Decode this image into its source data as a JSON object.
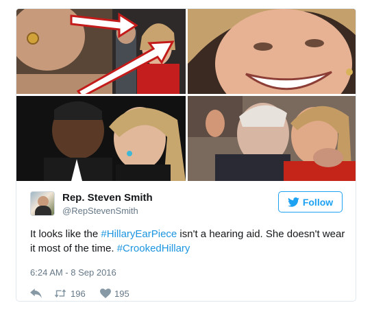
{
  "author": {
    "name": "Rep. Steven Smith",
    "handle": "@RepStevenSmith"
  },
  "follow_button": {
    "label": "Follow"
  },
  "tweet": {
    "text_before": "It looks like the ",
    "hashtag1": "#HillaryEarPiece",
    "text_middle": " isn't a hearing aid. She doesn't wear it most of the time. ",
    "hashtag2": "#CrookedHillary",
    "timestamp": "6:24 AM - 8 Sep 2016"
  },
  "actions": {
    "retweets": "196",
    "likes": "195"
  },
  "colors": {
    "accent": "#1da1f2",
    "hashtag": "#1b95e0",
    "muted": "#657786",
    "arrow": "#c31a1a"
  },
  "icons": [
    "reply-icon",
    "retweet-icon",
    "heart-icon",
    "twitter-bird-icon"
  ]
}
